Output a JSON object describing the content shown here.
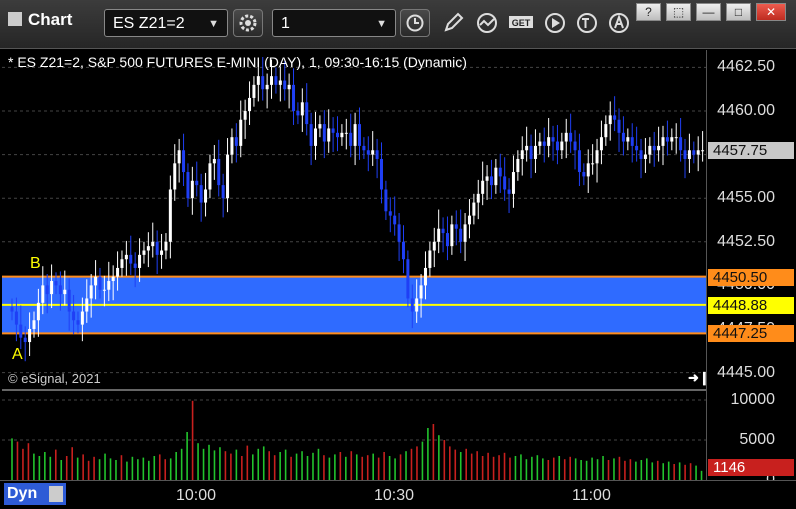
{
  "toolbar": {
    "title": "Chart",
    "symbol": "ES Z21=2",
    "interval": "1",
    "buttons": [
      "settings-icon",
      "clock-icon",
      "pencil-icon",
      "indicator-icon",
      "get-icon",
      "play-icon",
      "text-icon",
      "alert-icon"
    ],
    "window_buttons": {
      "help": "?",
      "restore": "⬚",
      "minimize": "—",
      "maximize": "□",
      "close": "✕"
    }
  },
  "chart_header": "* ES Z21=2, S&P 500 FUTURES E-MINI (DAY), 1, 09:30-16:15 (Dynamic)",
  "copyright": "© eSignal, 2021",
  "labels": {
    "a": "A",
    "b": "B"
  },
  "colors": {
    "up": "#ffffff",
    "down": "#1f3ff5",
    "zone": "#2f6bff",
    "zone_border": "#ff8c1a",
    "mid_line": "#ffff00",
    "vol_up": "#22c42d",
    "vol_down": "#c8201e"
  },
  "price_axis": {
    "ticks": [
      "4462.50",
      "4460.00",
      "4457.50",
      "4455.00",
      "4452.50",
      "4450.00",
      "4447.50",
      "4445.00"
    ]
  },
  "price_tags": {
    "last": "4457.75",
    "upper": "4450.50",
    "mid": "4448.88",
    "lower": "4447.25"
  },
  "volume_axis": {
    "ticks": [
      "10000",
      "5000",
      "0"
    ],
    "last": "1146"
  },
  "time_axis": {
    "ticks": [
      "10:00",
      "10:30",
      "11:00"
    ]
  },
  "footer": {
    "mode": "Dyn"
  },
  "chart_data": {
    "type": "candlestick",
    "title": "* ES Z21=2, S&P 500 FUTURES E-MINI (DAY), 1, 09:30-16:15 (Dynamic)",
    "ylim": [
      4444.0,
      4463.5
    ],
    "zone": {
      "upper": 4450.5,
      "mid": 4448.88,
      "lower": 4447.25
    },
    "x_ticks": [
      "10:00",
      "10:30",
      "11:00"
    ],
    "start_time": "09:30",
    "close": [
      4448.5,
      4447.75,
      4447.0,
      4446.75,
      4447.5,
      4448.0,
      4449.0,
      4450.0,
      4449.5,
      4450.25,
      4450.0,
      4449.5,
      4449.75,
      4448.5,
      4448.0,
      4447.75,
      4448.5,
      4449.25,
      4450.0,
      4450.5,
      4449.75,
      4449.75,
      4450.25,
      4450.5,
      4451.0,
      4451.5,
      4451.75,
      4451.25,
      4451.0,
      4451.75,
      4452.0,
      4452.25,
      4452.5,
      4451.75,
      4452.0,
      4452.5,
      4455.5,
      4457.0,
      4457.75,
      4456.5,
      4455.0,
      4456.0,
      4455.75,
      4454.75,
      4455.5,
      4457.0,
      4457.25,
      4455.75,
      4455.0,
      4457.5,
      4458.5,
      4458.0,
      4459.5,
      4460.0,
      4460.75,
      4461.5,
      4462.0,
      4461.25,
      4461.5,
      4462.0,
      4461.5,
      4461.75,
      4461.25,
      4461.5,
      4460.0,
      4459.75,
      4460.5,
      4459.25,
      4458.0,
      4459.0,
      4459.25,
      4458.25,
      4459.0,
      4458.75,
      4458.5,
      4458.75,
      4458.75,
      4458.0,
      4459.25,
      4458.0,
      4457.75,
      4457.5,
      4457.75,
      4457.25,
      4455.5,
      4454.25,
      4454.0,
      4453.5,
      4452.5,
      4451.5,
      4449.25,
      4448.5,
      4449.25,
      4450.0,
      4451.0,
      4452.0,
      4452.5,
      4453.25,
      4453.0,
      4452.25,
      4453.5,
      4453.25,
      4452.5,
      4453.5,
      4454.0,
      4454.75,
      4455.25,
      4456.0,
      4456.25,
      4455.75,
      4456.75,
      4456.25,
      4455.5,
      4455.25,
      4456.5,
      4457.25,
      4457.75,
      4458.0,
      4457.25,
      4458.0,
      4458.25,
      4458.0,
      4458.5,
      4458.25,
      4457.75,
      4458.25,
      4458.75,
      4458.25,
      4457.75,
      4456.5,
      4456.25,
      4457.0,
      4457.0,
      4457.75,
      4458.5,
      4459.25,
      4459.75,
      4459.5,
      4458.75,
      4458.25,
      4458.5,
      4458.0,
      4457.75,
      4457.25,
      4457.5,
      4458.0,
      4457.75,
      4458.0,
      4458.5,
      4458.25,
      4458.5,
      4458.5,
      4457.75,
      4457.25,
      4457.75,
      4457.5,
      4457.75,
      4457.75
    ],
    "volume": [
      5200,
      4800,
      3900,
      4600,
      3300,
      3000,
      3500,
      2900,
      3800,
      2500,
      3000,
      4100,
      2800,
      3200,
      2400,
      2900,
      2600,
      3300,
      2700,
      2500,
      3100,
      2300,
      2900,
      2600,
      2800,
      2400,
      3000,
      3200,
      2600,
      2700,
      3500,
      3900,
      6000,
      9900,
      4600,
      3900,
      4400,
      3700,
      4100,
      3600,
      3300,
      3800,
      3000,
      4300,
      3200,
      3900,
      4200,
      3600,
      3100,
      3500,
      3800,
      2900,
      3300,
      3600,
      3000,
      3400,
      3900,
      3100,
      2800,
      3200,
      3500,
      2900,
      3600,
      3200,
      2900,
      3100,
      3300,
      2800,
      3500,
      3000,
      2700,
      3200,
      3600,
      3900,
      4200,
      4800,
      6500,
      7000,
      5600,
      5000,
      4200,
      3800,
      3500,
      3900,
      3300,
      3600,
      3000,
      3400,
      2900,
      3100,
      3400,
      2800,
      3000,
      3200,
      2600,
      2900,
      3100,
      2700,
      2500,
      2800,
      3000,
      2600,
      2900,
      2700,
      2500,
      2400,
      2800,
      2600,
      3000,
      2500,
      2700,
      2900,
      2400,
      2600,
      2300,
      2500,
      2700,
      2200,
      2400,
      2100,
      2300,
      2000,
      2200,
      1900,
      2100,
      1800,
      1146
    ]
  }
}
